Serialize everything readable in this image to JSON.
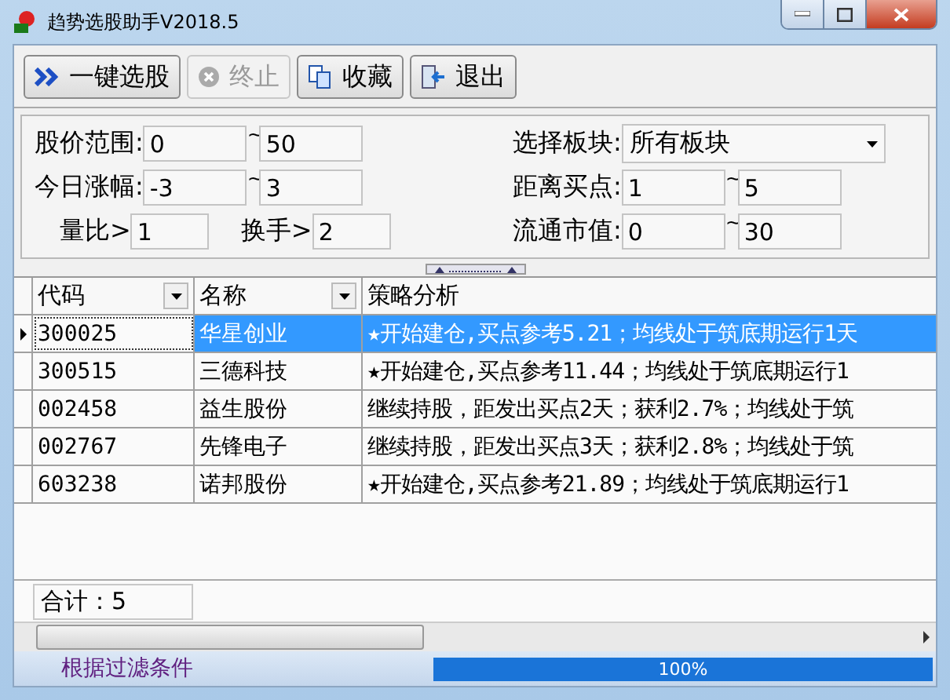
{
  "window": {
    "title": "趋势选股助手V2018.5"
  },
  "toolbar": [
    {
      "label": "一键选股",
      "kind": "run",
      "disabled": false
    },
    {
      "label": "终止",
      "kind": "stop",
      "disabled": true
    },
    {
      "label": "收藏",
      "kind": "save",
      "disabled": false
    },
    {
      "label": "退出",
      "kind": "exit",
      "disabled": false
    }
  ],
  "filters": {
    "price": {
      "label": "股价范围:",
      "from": "0",
      "sep": "~",
      "to": "50"
    },
    "change": {
      "label": "今日涨幅:",
      "from": "-3",
      "sep": "~",
      "to": "3"
    },
    "volume_ratio": {
      "label": "量比>",
      "value": "1"
    },
    "turnover": {
      "label": "换手>",
      "value": "2"
    },
    "sector": {
      "label": "选择板块:",
      "value": "所有板块"
    },
    "distance": {
      "label": "距离买点:",
      "from": "1",
      "sep": "~",
      "to": "5"
    },
    "market_cap": {
      "label": "流通市值:",
      "from": "0",
      "sep": "~",
      "to": "30"
    }
  },
  "table": {
    "columns": [
      {
        "label": "代码",
        "filter": true
      },
      {
        "label": "名称",
        "filter": true
      },
      {
        "label": "策略分析",
        "filter": false
      }
    ],
    "rows": [
      {
        "selected": true,
        "cells": [
          "300025",
          "华星创业",
          "★开始建仓,买点参考5.21；均线处于筑底期运行1天"
        ]
      },
      {
        "selected": false,
        "cells": [
          "300515",
          "三德科技",
          "★开始建仓,买点参考11.44；均线处于筑底期运行1"
        ]
      },
      {
        "selected": false,
        "cells": [
          "002458",
          "益生股份",
          "继续持股，距发出买点2天；获利2.7%；均线处于筑"
        ]
      },
      {
        "selected": false,
        "cells": [
          "002767",
          "先锋电子",
          "继续持股，距发出买点3天；获利2.8%；均线处于筑"
        ]
      },
      {
        "selected": false,
        "cells": [
          "603238",
          "诺邦股份",
          "★开始建仓,买点参考21.89；均线处于筑底期运行1"
        ]
      }
    ]
  },
  "total": "合计：5",
  "status_bar": {
    "message": "根据过滤条件",
    "progress": {
      "level": 1.0,
      "reading": "100%"
    }
  }
}
